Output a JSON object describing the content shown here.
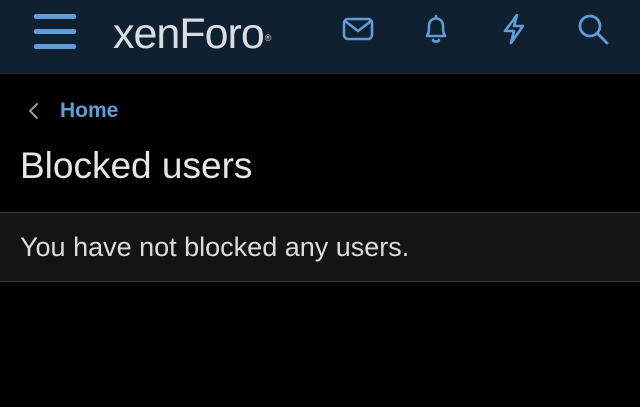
{
  "header": {
    "logo_text": "xenForo",
    "logo_mark": "®",
    "colors": {
      "background": "#102030",
      "accent": "#5f9cd8",
      "logo": "#d8dde2"
    },
    "icons": [
      "hamburger-menu-icon",
      "envelope-icon",
      "bell-icon",
      "lightning-bolt-icon",
      "search-icon"
    ]
  },
  "breadcrumb": {
    "back_icon": "chevron-left-icon",
    "home_label": "Home"
  },
  "page": {
    "title": "Blocked users",
    "message": "You have not blocked any users."
  }
}
